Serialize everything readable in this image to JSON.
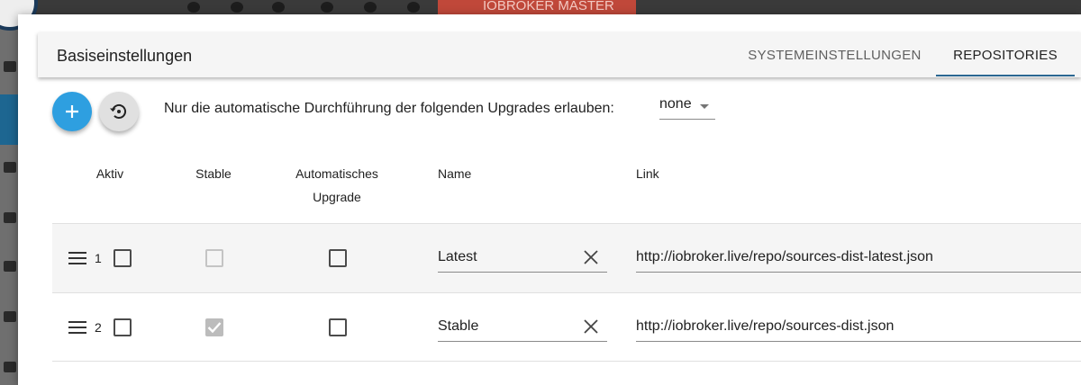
{
  "background": {
    "banner_text": "IOBROKER MASTER"
  },
  "header": {
    "title": "Basiseinstellungen",
    "tabs": [
      {
        "label": "SYSTEMEINSTELLUNGEN",
        "active": false
      },
      {
        "label": "REPOSITORIES",
        "active": true
      }
    ]
  },
  "toolbar": {
    "add_icon": "plus-icon",
    "restore_icon": "restore-icon",
    "upgrade_label": "Nur die automatische Durchführung der folgenden Upgrades erlauben:",
    "upgrade_value": "none"
  },
  "table": {
    "headers": {
      "aktiv": "Aktiv",
      "stable": "Stable",
      "auto_upgrade_line1": "Automatisches",
      "auto_upgrade_line2": "Upgrade",
      "name": "Name",
      "link": "Link"
    },
    "rows": [
      {
        "index": "1",
        "aktiv": false,
        "stable": false,
        "stable_disabled": true,
        "auto_upgrade": false,
        "name": "Latest",
        "link": "http://iobroker.live/repo/sources-dist-latest.json"
      },
      {
        "index": "2",
        "aktiv": false,
        "stable": true,
        "stable_disabled": true,
        "auto_upgrade": false,
        "name": "Stable",
        "link": "http://iobroker.live/repo/sources-dist.json"
      }
    ]
  },
  "colors": {
    "accent": "#2e9fe0",
    "tab_indicator": "#2b6792",
    "row_alt": "#f5f5f5"
  }
}
